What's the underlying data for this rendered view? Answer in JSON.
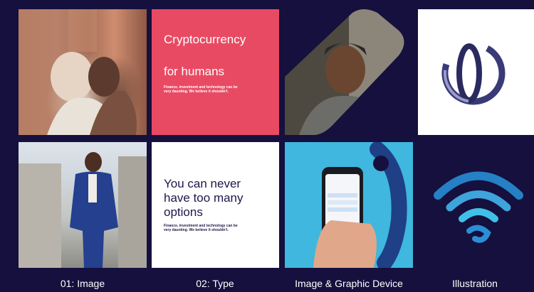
{
  "cards": {
    "crypto_title_line1": "Cryptocurrency",
    "crypto_title_line2": "for humans",
    "crypto_body": "Finance, investment and technology can be very daunting. We believe it shouldn't.",
    "options_title_line1": "You can never",
    "options_title_line2": "have too many",
    "options_title_line3": "options",
    "options_body": "Finance, investment and technology can be very daunting. We believe it shouldn't."
  },
  "captions": {
    "image": "01: Image",
    "type": "02: Type",
    "device": "Image & Graphic Device",
    "illustration": "Illustration"
  },
  "colors": {
    "background": "#15103d",
    "accent_red": "#e94a63",
    "accent_cyan": "#3fb7de",
    "navy": "#1d1748"
  }
}
